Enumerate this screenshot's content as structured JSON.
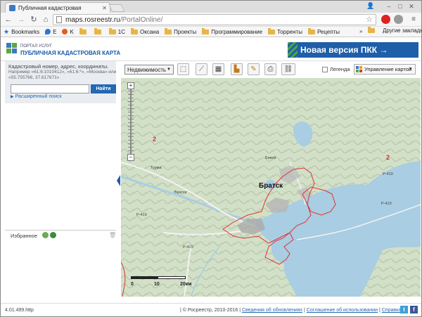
{
  "browser": {
    "tab_title": "Публичная кадастровая",
    "url_host": "maps.rosreestr.ru",
    "url_path": "/PortalOnline/"
  },
  "bookmarks": [
    {
      "label": "Bookmarks",
      "icon": "star-icon"
    },
    {
      "label": "E",
      "icon": "drop-icon"
    },
    {
      "label": "K",
      "icon": "circle-icon"
    },
    {
      "label": "",
      "icon": "folder-icon"
    },
    {
      "label": "",
      "icon": "folder-icon"
    },
    {
      "label": "1С",
      "icon": "folder-icon"
    },
    {
      "label": "Оксана",
      "icon": "folder-icon"
    },
    {
      "label": "Проекты",
      "icon": "folder-icon"
    },
    {
      "label": "Программирование",
      "icon": "folder-icon"
    },
    {
      "label": "Торренты",
      "icon": "folder-icon"
    },
    {
      "label": "Рецепты",
      "icon": "folder-icon"
    }
  ],
  "bookmarks_more": "»",
  "bookmarks_other": "Другие закладки",
  "header": {
    "portal_small": "ПОРТАЛ УСЛУГ",
    "portal_main": "ПУБЛИЧНАЯ КАДАСТРОВАЯ КАРТА",
    "new_version": "Новая версия ПКК →"
  },
  "search": {
    "hint_title": "Кадастровый номер, адрес, координаты.",
    "hint_examples": "Например «61:6:1010412», «61:6:*», «Москва» или «55.755766, 37.617671»",
    "input_value": "",
    "find_label": "Найти",
    "advanced_label": "Расширенный поиск"
  },
  "favorites": {
    "title": "Избранное"
  },
  "map_toolbar": {
    "layer_select": "Недвижимость",
    "legend_label": "Легенда",
    "map_control_label": "Управление картой"
  },
  "map": {
    "city": "Братск",
    "zone_left": "2",
    "zone_right": "2",
    "places": [
      "Турма",
      "Бикей",
      "Братск",
      "Р-419",
      "Р-419",
      "Р-419",
      "Р-419"
    ],
    "scale_labels": [
      "0",
      "10",
      "20км"
    ]
  },
  "footer": {
    "version": "4.01.499.http",
    "copyright": "| © Росреестр, 2010-2016 |",
    "link_updates": "Сведения об обновлениях",
    "sep1": "|",
    "link_terms": "Соглашение об использовании",
    "sep2": "|",
    "link_help": "Справка",
    "sep3": "|"
  }
}
